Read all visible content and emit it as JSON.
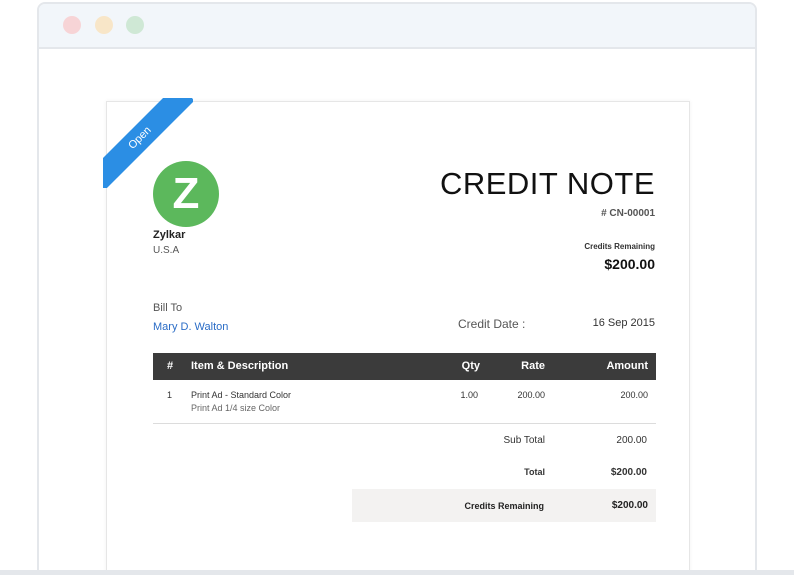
{
  "window": {
    "controls": [
      "close",
      "minimize",
      "maximize"
    ],
    "colors": {
      "close": "#f7d4d6",
      "minimize": "#f8e6c8",
      "maximize": "#cfe8d5"
    }
  },
  "status_ribbon": {
    "label": "Open",
    "color": "#2b8ee4"
  },
  "company": {
    "logo_letter": "Z",
    "logo_color": "#5cb85c",
    "name": "Zylkar",
    "country": "U.S.A"
  },
  "document": {
    "title": "CREDIT NOTE",
    "number": "# CN-00001",
    "credits_remaining_label": "Credits Remaining",
    "credits_remaining_value": "$200.00"
  },
  "bill_to": {
    "label": "Bill To",
    "name": "Mary D. Walton"
  },
  "credit_date": {
    "label": "Credit Date :",
    "value": "16 Sep 2015"
  },
  "table": {
    "headers": {
      "num": "#",
      "item": "Item & Description",
      "qty": "Qty",
      "rate": "Rate",
      "amount": "Amount"
    },
    "rows": [
      {
        "num": "1",
        "item": "Print Ad - Standard Color",
        "description": "Print Ad 1/4 size Color",
        "qty": "1.00",
        "rate": "200.00",
        "amount": "200.00"
      }
    ]
  },
  "summary": {
    "sub_total_label": "Sub Total",
    "sub_total_value": "200.00",
    "total_label": "Total",
    "total_value": "$200.00",
    "credits_remaining_label": "Credits Remaining",
    "credits_remaining_value": "$200.00"
  }
}
